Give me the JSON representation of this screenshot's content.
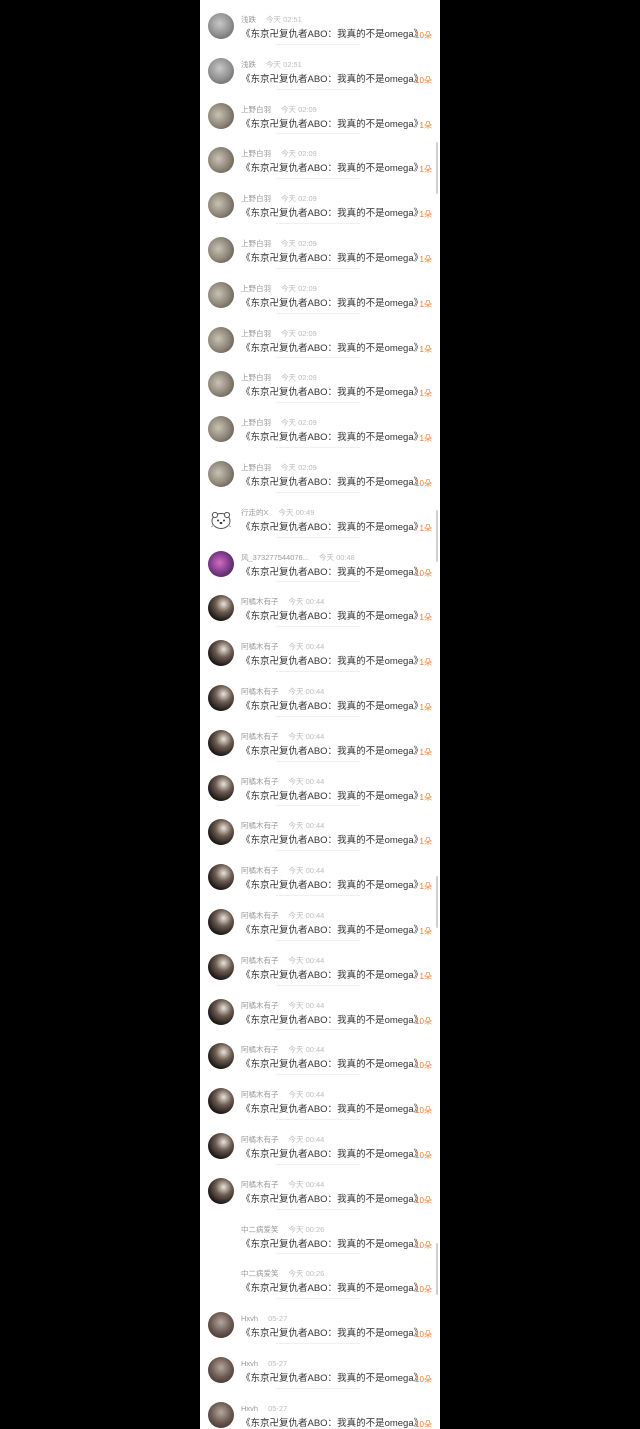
{
  "message_text": "《东京卍复仇者ABO：我真的不是omega》",
  "rows": [
    {
      "user": "浅跌",
      "time": "今天 02:51",
      "count": "10朵",
      "avatar": "grey"
    },
    {
      "user": "浅跌",
      "time": "今天 02:51",
      "count": "10朵",
      "avatar": "grey"
    },
    {
      "user": "上野白羽",
      "time": "今天 02:09",
      "count": "1朵",
      "avatar": "sepia"
    },
    {
      "user": "上野白羽",
      "time": "今天 02:09",
      "count": "1朵",
      "avatar": "sepia"
    },
    {
      "user": "上野白羽",
      "time": "今天 02:09",
      "count": "1朵",
      "avatar": "sepia"
    },
    {
      "user": "上野白羽",
      "time": "今天 02:09",
      "count": "1朵",
      "avatar": "sepia"
    },
    {
      "user": "上野白羽",
      "time": "今天 02:09",
      "count": "1朵",
      "avatar": "sepia"
    },
    {
      "user": "上野白羽",
      "time": "今天 02:09",
      "count": "1朵",
      "avatar": "sepia"
    },
    {
      "user": "上野白羽",
      "time": "今天 02:09",
      "count": "1朵",
      "avatar": "sepia"
    },
    {
      "user": "上野白羽",
      "time": "今天 02:09",
      "count": "1朵",
      "avatar": "sepia"
    },
    {
      "user": "上野白羽",
      "time": "今天 02:09",
      "count": "10朵",
      "avatar": "sepia"
    },
    {
      "user": "行走的X",
      "time": "今天 00:49",
      "count": "1朵",
      "avatar": "bear"
    },
    {
      "user": "风_373277544076...",
      "time": "今天 00:48",
      "count": "10朵",
      "avatar": "purple"
    },
    {
      "user": "阿橘木有子",
      "time": "今天 00:44",
      "count": "1朵",
      "avatar": "dark"
    },
    {
      "user": "阿橘木有子",
      "time": "今天 00:44",
      "count": "1朵",
      "avatar": "dark"
    },
    {
      "user": "阿橘木有子",
      "time": "今天 00:44",
      "count": "1朵",
      "avatar": "dark"
    },
    {
      "user": "阿橘木有子",
      "time": "今天 00:44",
      "count": "1朵",
      "avatar": "dark"
    },
    {
      "user": "阿橘木有子",
      "time": "今天 00:44",
      "count": "1朵",
      "avatar": "dark"
    },
    {
      "user": "阿橘木有子",
      "time": "今天 00:44",
      "count": "1朵",
      "avatar": "dark"
    },
    {
      "user": "阿橘木有子",
      "time": "今天 00:44",
      "count": "1朵",
      "avatar": "dark"
    },
    {
      "user": "阿橘木有子",
      "time": "今天 00:44",
      "count": "1朵",
      "avatar": "dark"
    },
    {
      "user": "阿橘木有子",
      "time": "今天 00:44",
      "count": "1朵",
      "avatar": "dark"
    },
    {
      "user": "阿橘木有子",
      "time": "今天 00:44",
      "count": "10朵",
      "avatar": "dark"
    },
    {
      "user": "阿橘木有子",
      "time": "今天 00:44",
      "count": "10朵",
      "avatar": "dark"
    },
    {
      "user": "阿橘木有子",
      "time": "今天 00:44",
      "count": "10朵",
      "avatar": "dark"
    },
    {
      "user": "阿橘木有子",
      "time": "今天 00:44",
      "count": "10朵",
      "avatar": "dark"
    },
    {
      "user": "阿橘木有子",
      "time": "今天 00:44",
      "count": "10朵",
      "avatar": "dark"
    },
    {
      "user": "中二病爱笑",
      "time": "今天 00:26",
      "count": "10朵",
      "avatar": "none"
    },
    {
      "user": "中二病爱笑",
      "time": "今天 00:26",
      "count": "10朵",
      "avatar": "none"
    },
    {
      "user": "Hxvh",
      "time": "05-27",
      "count": "10朵",
      "avatar": "brown"
    },
    {
      "user": "Hxvh",
      "time": "05-27",
      "count": "10朵",
      "avatar": "brown"
    },
    {
      "user": "Hxvh",
      "time": "05-27",
      "count": "10朵",
      "avatar": "brown"
    }
  ]
}
